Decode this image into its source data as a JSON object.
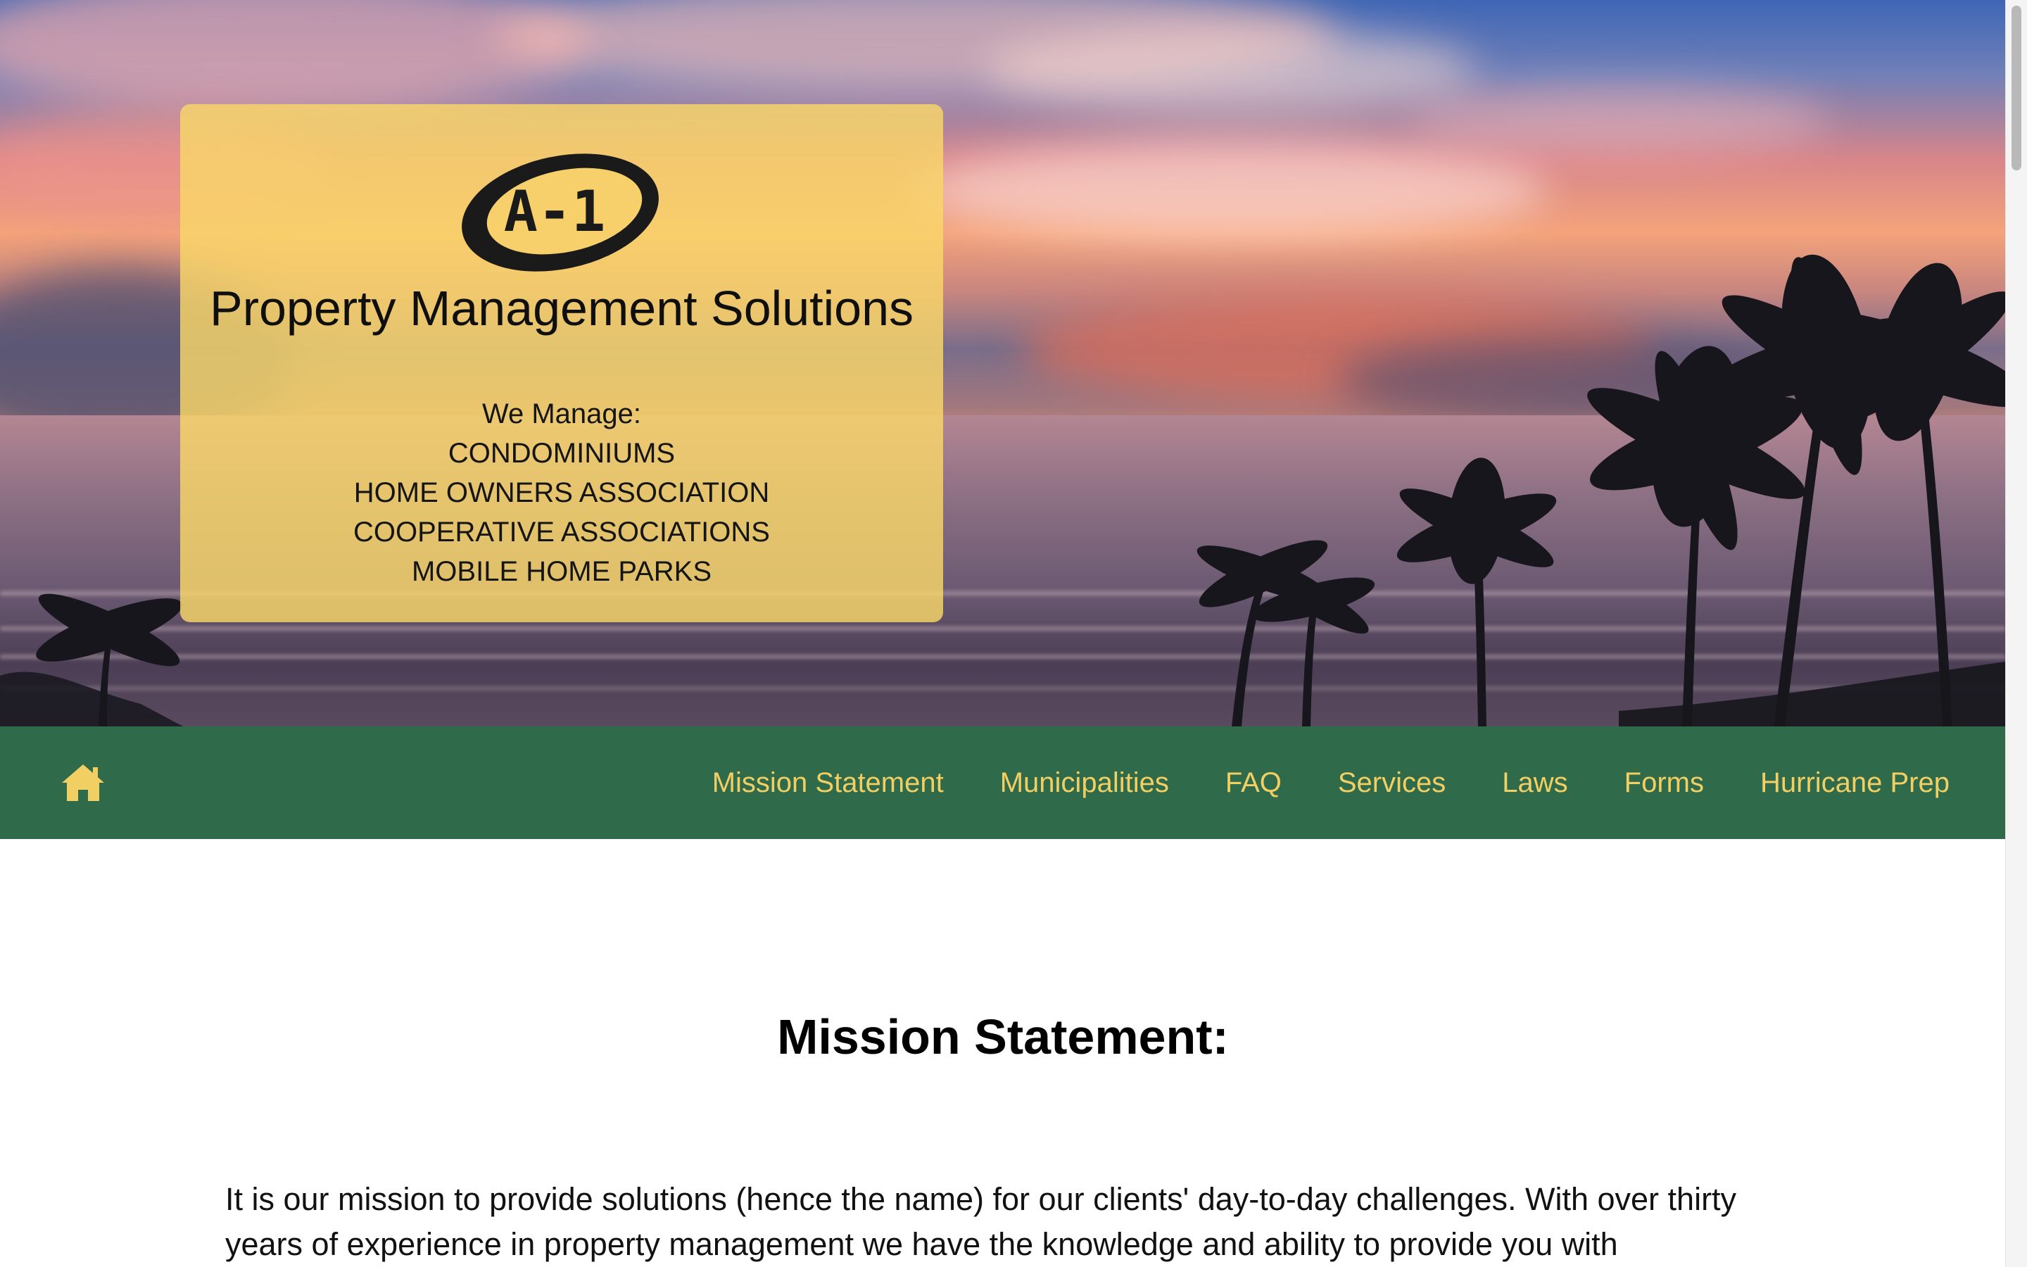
{
  "brand": {
    "logo_text": "A-1",
    "company_name": "Property Management Solutions"
  },
  "manage": {
    "heading": "We Manage:",
    "items": [
      "CONDOMINIUMS",
      "HOME OWNERS ASSOCIATION",
      "COOPERATIVE ASSOCIATIONS",
      "MOBILE HOME PARKS"
    ]
  },
  "nav": {
    "home_icon": "home-icon",
    "items": [
      "Mission Statement",
      "Municipalities",
      "FAQ",
      "Services",
      "Laws",
      "Forms",
      "Hurricane Prep"
    ]
  },
  "content": {
    "title": "Mission Statement:",
    "paragraph": "It is our mission to provide solutions (hence the name) for our clients' day-to-day challenges. With over thirty years of experience in property management we have the knowledge and ability to provide you with"
  },
  "colors": {
    "nav_background": "#2f6a4a",
    "nav_text": "#f2cf63",
    "card_background": "#f9d769"
  }
}
